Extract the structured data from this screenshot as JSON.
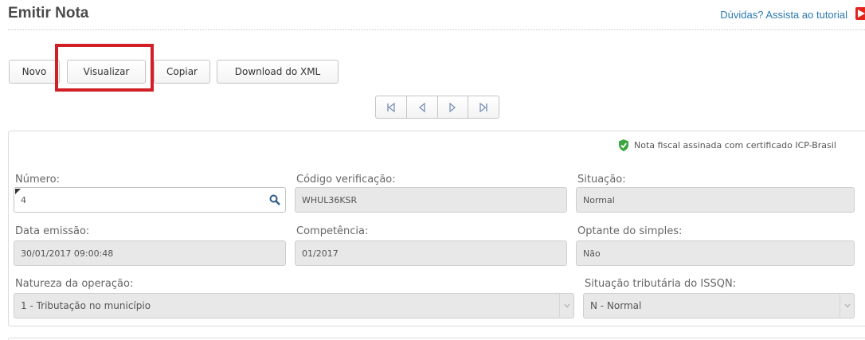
{
  "header": {
    "title": "Emitir Nota",
    "help_link": "Dúvidas? Assista ao tutorial"
  },
  "toolbar": {
    "novo": "Novo",
    "visualizar": "Visualizar",
    "copiar": "Copiar",
    "download_xml": "Download do XML"
  },
  "pager": {
    "icons": [
      "first-page-icon",
      "previous-page-icon",
      "next-page-icon",
      "last-page-icon"
    ]
  },
  "form": {
    "cert_note": "Nota fiscal assinada com certificado ICP-Brasil",
    "numero": {
      "label": "Número:",
      "value": "4"
    },
    "codigo_verificacao": {
      "label": "Código verificação:",
      "value": "WHUL36KSR"
    },
    "situacao": {
      "label": "Situação:",
      "value": "Normal"
    },
    "data_emissao": {
      "label": "Data emissão:",
      "value": "30/01/2017 09:00:48"
    },
    "competencia": {
      "label": "Competência:",
      "value": "01/2017"
    },
    "optante_simples": {
      "label": "Optante do simples:",
      "value": "Não"
    },
    "natureza_operacao": {
      "label": "Natureza da operação:",
      "value": "1 - Tributação no município"
    },
    "situacao_tributaria": {
      "label": "Situação tributária do ISSQN:",
      "value": "N - Normal"
    }
  },
  "colors": {
    "link": "#2a7ab0",
    "highlight": "#d11f26",
    "shield": "#3aa63d",
    "youtube": "#e1251b"
  }
}
